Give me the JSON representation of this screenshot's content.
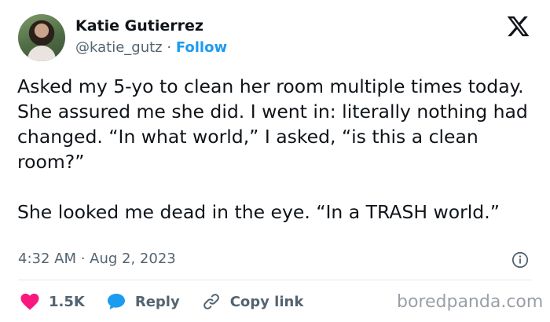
{
  "author": {
    "name": "Katie Gutierrez",
    "handle": "@katie_gutz",
    "separator": "·",
    "follow_label": "Follow"
  },
  "tweet": {
    "text": "Asked my 5-yo to clean her room multiple times today. She assured me she did. I went in: literally nothing had changed. “In what world,” I asked, “is this a clean room?”\n\nShe looked me dead in the eye. “In a TRASH world.”",
    "timestamp": "4:32 AM · Aug 2, 2023"
  },
  "actions": {
    "likes": "1.5K",
    "reply_label": "Reply",
    "copy_link_label": "Copy link"
  },
  "icons": {
    "platform": "x-logo-icon",
    "info": "info-icon",
    "like": "heart-icon",
    "reply": "speech-bubble-icon",
    "copy": "link-icon"
  },
  "colors": {
    "follow": "#1d9bf0",
    "heart": "#f91880",
    "reply": "#1d9bf0",
    "secondary_text": "#536471"
  },
  "watermark": "boredpanda.com"
}
